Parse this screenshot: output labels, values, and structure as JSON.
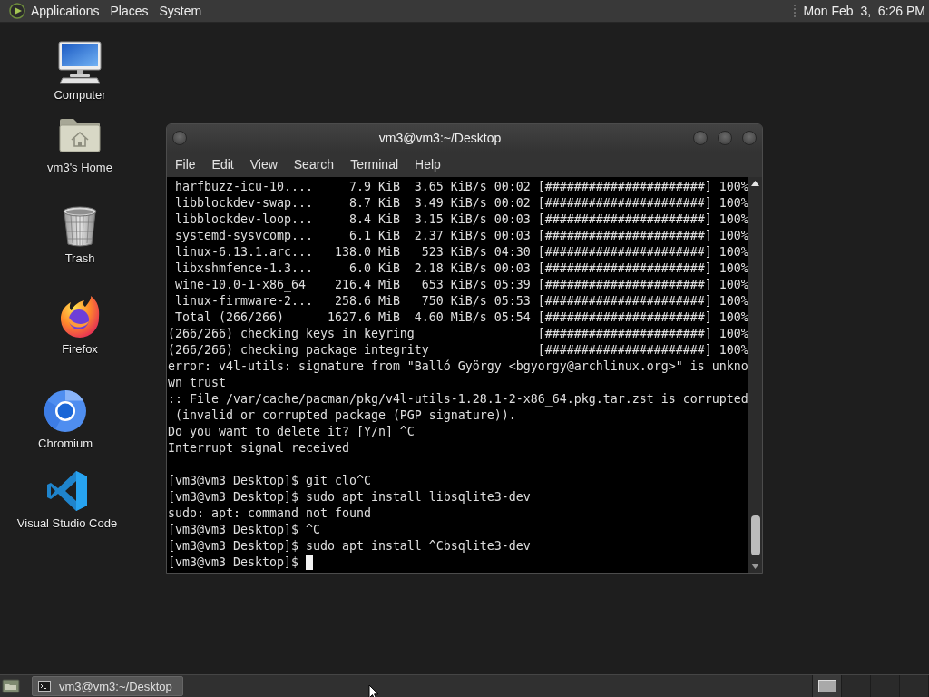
{
  "top_panel": {
    "menus": [
      "Applications",
      "Places",
      "System"
    ],
    "clock": "Mon Feb  3,  6:26 PM"
  },
  "desktop_icons": [
    {
      "kind": "computer",
      "label": "Computer"
    },
    {
      "kind": "home",
      "label": "vm3's Home"
    },
    {
      "kind": "trash",
      "label": "Trash"
    },
    {
      "kind": "firefox",
      "label": "Firefox"
    },
    {
      "kind": "chromium",
      "label": "Chromium"
    },
    {
      "kind": "vscode",
      "label": "Visual Studio Code"
    }
  ],
  "terminal_window": {
    "title": "vm3@vm3:~/Desktop",
    "menus": [
      "File",
      "Edit",
      "View",
      "Search",
      "Terminal",
      "Help"
    ],
    "blocks": [
      [
        " harfbuzz-icu-10....     7.9 KiB  3.65 KiB/s 00:02 [######################] 100%",
        " libblockdev-swap...     8.7 KiB  3.49 KiB/s 00:02 [######################] 100%",
        " libblockdev-loop...     8.4 KiB  3.15 KiB/s 00:03 [######################] 100%",
        " systemd-sysvcomp...     6.1 KiB  2.37 KiB/s 00:03 [######################] 100%",
        " linux-6.13.1.arc...   138.0 MiB   523 KiB/s 04:30 [######################] 100%",
        " libxshmfence-1.3...     6.0 KiB  2.18 KiB/s 00:03 [######################] 100%",
        " wine-10.0-1-x86_64    216.4 MiB   653 KiB/s 05:39 [######################] 100%",
        " linux-firmware-2...   258.6 MiB   750 KiB/s 05:53 [######################] 100%",
        " Total (266/266)      1627.6 MiB  4.60 MiB/s 05:54 [######################] 100%",
        "(266/266) checking keys in keyring                 [######################] 100%",
        "(266/266) checking package integrity               [######################] 100%",
        "error: v4l-utils: signature from \"Balló György <bgyorgy@archlinux.org>\" is unkno",
        "wn trust",
        ":: File /var/cache/pacman/pkg/v4l-utils-1.28.1-2-x86_64.pkg.tar.zst is corrupted",
        " (invalid or corrupted package (PGP signature)).",
        "Do you want to delete it? [Y/n] ^C",
        "Interrupt signal received"
      ],
      [
        "[vm3@vm3 Desktop]$ git clo^C",
        "[vm3@vm3 Desktop]$ sudo apt install libsqlite3-dev",
        "sudo: apt: command not found",
        "[vm3@vm3 Desktop]$ ^C",
        "[vm3@vm3 Desktop]$ sudo apt install ^Cbsqlite3-dev",
        "[vm3@vm3 Desktop]$ "
      ]
    ],
    "cursor": true
  },
  "bottom_panel": {
    "tasks": [
      {
        "label": "vm3@vm3:~/Desktop",
        "selected": true
      }
    ],
    "workspaces": [
      {
        "selected": true,
        "has_window": true
      },
      {
        "selected": false,
        "has_window": false
      },
      {
        "selected": false,
        "has_window": false
      },
      {
        "selected": false,
        "has_window": false
      }
    ]
  }
}
